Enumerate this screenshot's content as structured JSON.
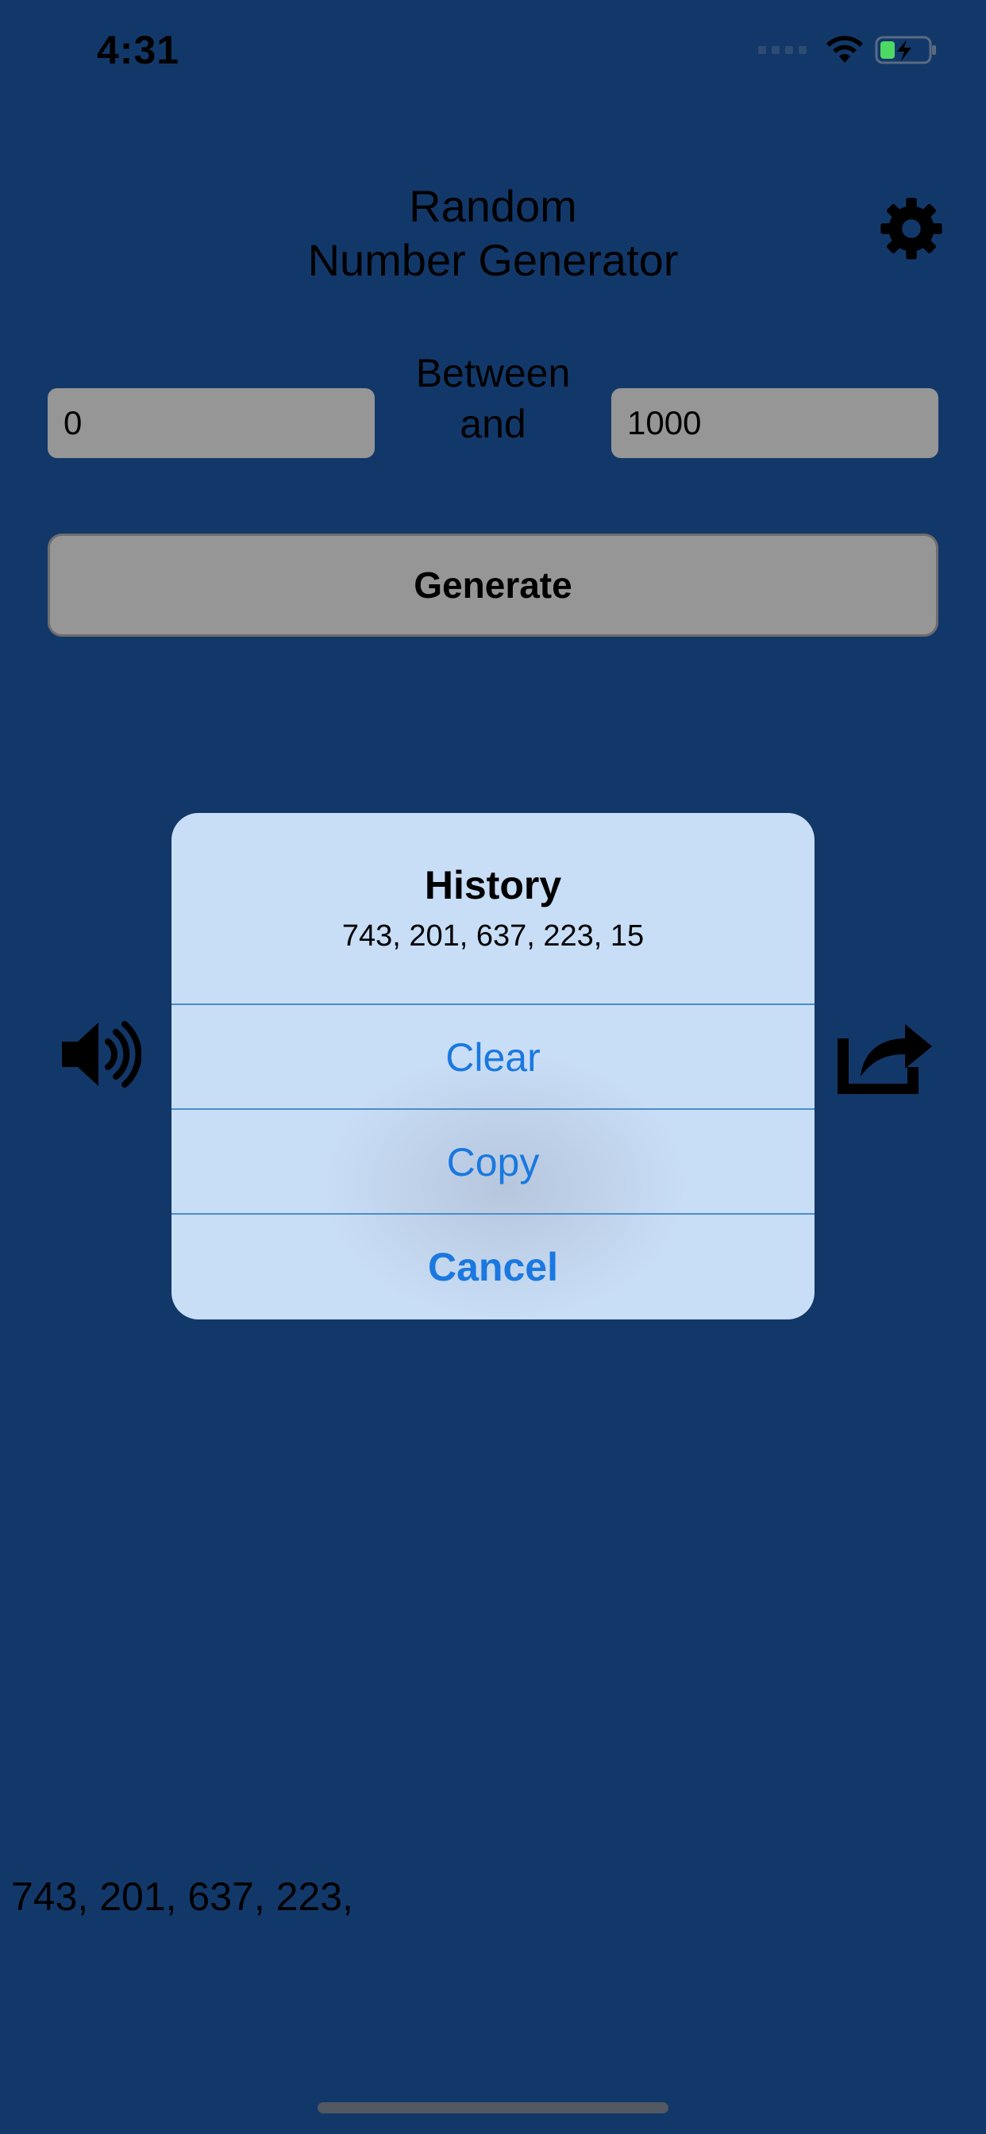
{
  "status_bar": {
    "time": "4:31",
    "icons": [
      "signal-dots-icon",
      "wifi-icon",
      "battery-charging-icon"
    ]
  },
  "header": {
    "title_line1": "Random",
    "title_line2": "Number Generator",
    "settings_icon": "gear-icon"
  },
  "range": {
    "min_value": "0",
    "max_value": "1000",
    "between_label": "Between",
    "and_label": "and"
  },
  "generate_button": {
    "label": "Generate"
  },
  "side_icons": {
    "left": "speaker-icon",
    "right": "share-icon"
  },
  "result": {
    "number_partial": "15"
  },
  "alert": {
    "title": "History",
    "message": "743, 201, 637, 223, 15",
    "actions": [
      {
        "label": "Clear"
      },
      {
        "label": "Copy"
      },
      {
        "label": "Cancel"
      }
    ]
  },
  "history_strip": {
    "text": "743, 201, 637, 223,"
  },
  "colors": {
    "background": "#12386a",
    "alert_background": "#c8ddf6",
    "action_text": "#1a78e0",
    "input_background": "#969696"
  }
}
